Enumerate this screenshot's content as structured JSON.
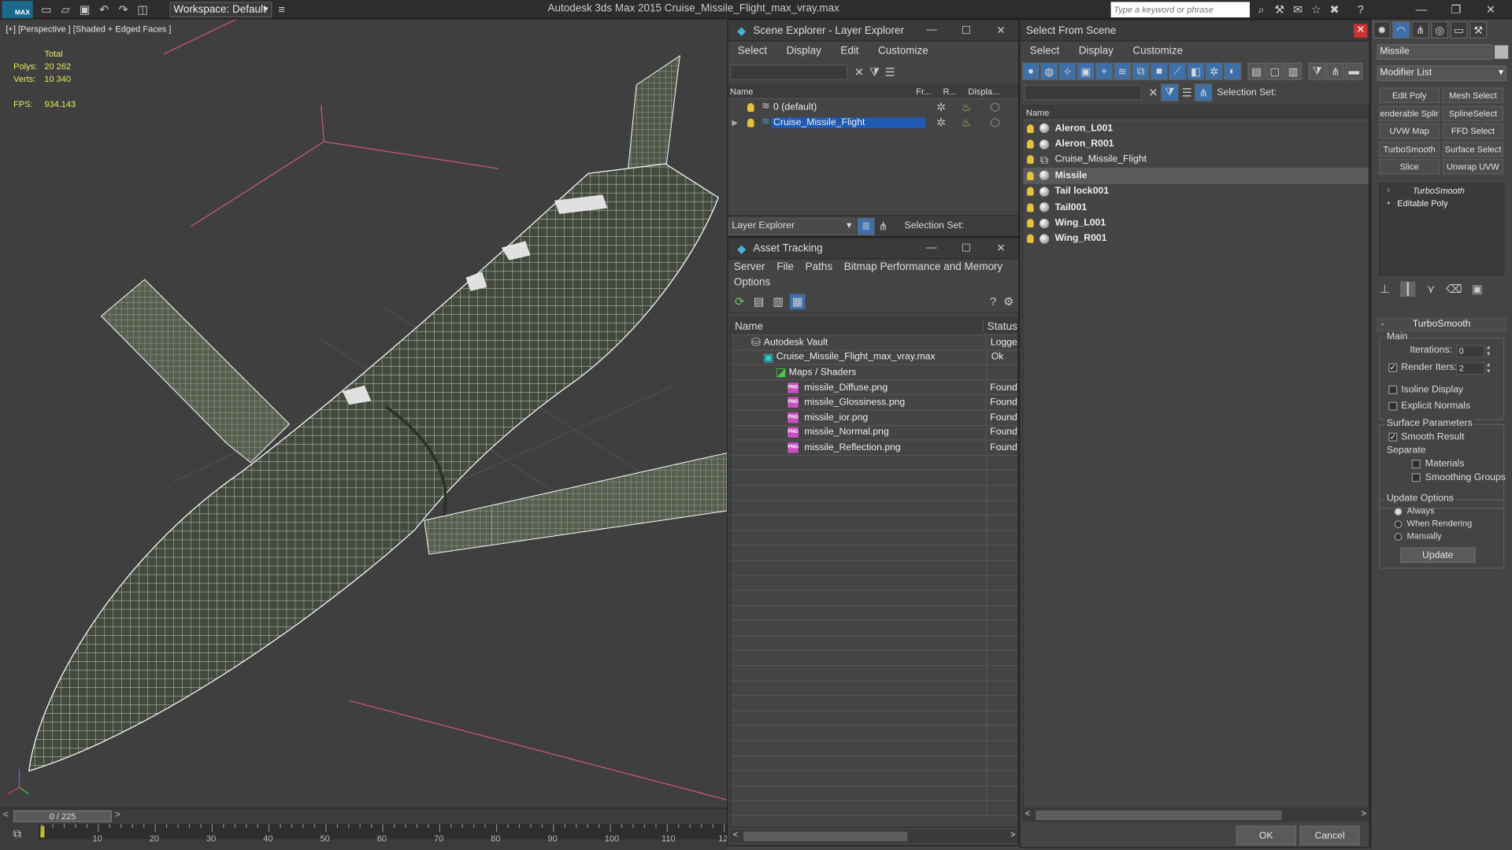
{
  "app": {
    "title": "Autodesk 3ds Max  2015     Cruise_Missile_Flight_max_vray.max",
    "logo": "MAX",
    "workspace": "Workspace: Default",
    "search_placeholder": "Type a keyword or phrase",
    "accent": "#1e5ab4"
  },
  "viewport": {
    "label": "[+] [Perspective ] [Shaded + Edged Faces ]",
    "stats": {
      "total_label": "Total",
      "polys_label": "Polys:",
      "polys": "20 262",
      "verts_label": "Verts:",
      "verts": "10 340",
      "fps_label": "FPS:",
      "fps": "934.143"
    }
  },
  "timeline": {
    "frame": "0 / 225",
    "ticks": [
      "10",
      "20",
      "30",
      "40",
      "50",
      "60",
      "70",
      "80",
      "90",
      "100",
      "110",
      "12"
    ]
  },
  "scene_explorer": {
    "title": "Scene Explorer - Layer Explorer",
    "menu": [
      "Select",
      "Display",
      "Edit",
      "Customize"
    ],
    "columns": [
      "Name",
      "Fr...",
      "R...",
      "Displa..."
    ],
    "layers": [
      {
        "name": "0 (default)",
        "selected": false
      },
      {
        "name": "Cruise_Missile_Flight",
        "selected": true
      }
    ],
    "footer_dropdown": "Layer Explorer",
    "selection_set_label": "Selection Set:"
  },
  "asset_tracking": {
    "title": "Asset Tracking",
    "menu": [
      "Server",
      "File",
      "Paths",
      "Bitmap Performance and Memory"
    ],
    "menu2": [
      "Options"
    ],
    "columns": [
      "Name",
      "Status"
    ],
    "rows": [
      {
        "name": "Autodesk Vault",
        "status": "Logge",
        "indent": 0,
        "kind": "vault"
      },
      {
        "name": "Cruise_Missile_Flight_max_vray.max",
        "status": "Ok",
        "indent": 1,
        "kind": "max"
      },
      {
        "name": "Maps / Shaders",
        "status": "",
        "indent": 2,
        "kind": "maps"
      },
      {
        "name": "missile_Diffuse.png",
        "status": "Found",
        "indent": 3,
        "kind": "png"
      },
      {
        "name": "missile_Glossiness.png",
        "status": "Found",
        "indent": 3,
        "kind": "png"
      },
      {
        "name": "missile_ior.png",
        "status": "Found",
        "indent": 3,
        "kind": "png"
      },
      {
        "name": "missile_Normal.png",
        "status": "Found",
        "indent": 3,
        "kind": "png"
      },
      {
        "name": "missile_Reflection.png",
        "status": "Found",
        "indent": 3,
        "kind": "png"
      }
    ],
    "png_badge": "PNG"
  },
  "select_from_scene": {
    "title": "Select From Scene",
    "menu": [
      "Select",
      "Display",
      "Customize"
    ],
    "selection_set_label": "Selection Set:",
    "column": "Name",
    "items": [
      {
        "name": "Aleron_L001",
        "bold": true,
        "selected": false,
        "kind": "sphere"
      },
      {
        "name": "Aleron_R001",
        "bold": true,
        "selected": false,
        "kind": "sphere"
      },
      {
        "name": "Cruise_Missile_Flight",
        "bold": false,
        "selected": false,
        "kind": "group"
      },
      {
        "name": "Missile",
        "bold": true,
        "selected": true,
        "kind": "sphere"
      },
      {
        "name": "Tail lock001",
        "bold": true,
        "selected": false,
        "kind": "sphere"
      },
      {
        "name": "Tail001",
        "bold": true,
        "selected": false,
        "kind": "sphere"
      },
      {
        "name": "Wing_L001",
        "bold": true,
        "selected": false,
        "kind": "sphere"
      },
      {
        "name": "Wing_R001",
        "bold": true,
        "selected": false,
        "kind": "sphere"
      }
    ],
    "ok": "OK",
    "cancel": "Cancel"
  },
  "command_panel": {
    "object_name": "Missile",
    "modifier_list": "Modifier List",
    "buttons": [
      "Edit Poly",
      "Mesh Select",
      "enderable Splir",
      "SplineSelect",
      "UVW Map",
      "FFD Select",
      "TurboSmooth",
      "Surface Select",
      "Slice",
      "Unwrap UVW"
    ],
    "stack": [
      {
        "name": "TurboSmooth",
        "italic": true
      },
      {
        "name": "Editable Poly",
        "italic": false
      }
    ],
    "rollout_title": "TurboSmooth",
    "main_label": "Main",
    "iterations_label": "Iterations:",
    "iterations": "0",
    "render_iters_label": "Render Iters:",
    "render_iters": "2",
    "isoline": "Isoline Display",
    "explicit_normals": "Explicit Normals",
    "surface_params": "Surface Parameters",
    "smooth_result": "Smooth Result",
    "separate": "Separate",
    "materials": "Materials",
    "smoothing_groups": "Smoothing Groups",
    "update_options": "Update Options",
    "always": "Always",
    "when_rendering": "When Rendering",
    "manually": "Manually",
    "update": "Update"
  }
}
